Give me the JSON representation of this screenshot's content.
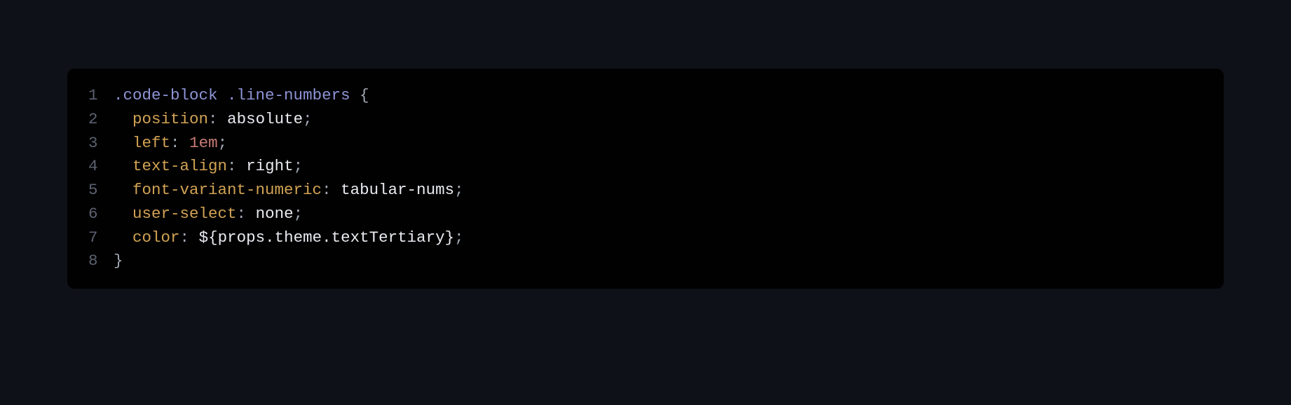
{
  "code": {
    "lines": [
      {
        "n": "1",
        "indent": "",
        "tokens": [
          {
            "cls": "tok-selector",
            "t": ".code-block"
          },
          {
            "cls": "tok-value",
            "t": " "
          },
          {
            "cls": "tok-selector",
            "t": ".line-numbers"
          },
          {
            "cls": "tok-value",
            "t": " "
          },
          {
            "cls": "tok-punct",
            "t": "{"
          }
        ]
      },
      {
        "n": "2",
        "indent": "  ",
        "tokens": [
          {
            "cls": "tok-prop",
            "t": "position"
          },
          {
            "cls": "tok-punct",
            "t": ":"
          },
          {
            "cls": "tok-value",
            "t": " absolute"
          },
          {
            "cls": "tok-punct",
            "t": ";"
          }
        ]
      },
      {
        "n": "3",
        "indent": "  ",
        "tokens": [
          {
            "cls": "tok-prop",
            "t": "left"
          },
          {
            "cls": "tok-punct",
            "t": ":"
          },
          {
            "cls": "tok-value",
            "t": " "
          },
          {
            "cls": "tok-num",
            "t": "1"
          },
          {
            "cls": "tok-unit",
            "t": "em"
          },
          {
            "cls": "tok-punct",
            "t": ";"
          }
        ]
      },
      {
        "n": "4",
        "indent": "  ",
        "tokens": [
          {
            "cls": "tok-prop",
            "t": "text-align"
          },
          {
            "cls": "tok-punct",
            "t": ":"
          },
          {
            "cls": "tok-value",
            "t": " right"
          },
          {
            "cls": "tok-punct",
            "t": ";"
          }
        ]
      },
      {
        "n": "5",
        "indent": "  ",
        "tokens": [
          {
            "cls": "tok-prop",
            "t": "font-variant-numeric"
          },
          {
            "cls": "tok-punct",
            "t": ":"
          },
          {
            "cls": "tok-value",
            "t": " tabular-nums"
          },
          {
            "cls": "tok-punct",
            "t": ";"
          }
        ]
      },
      {
        "n": "6",
        "indent": "  ",
        "tokens": [
          {
            "cls": "tok-prop",
            "t": "user-select"
          },
          {
            "cls": "tok-punct",
            "t": ":"
          },
          {
            "cls": "tok-value",
            "t": " none"
          },
          {
            "cls": "tok-punct",
            "t": ";"
          }
        ]
      },
      {
        "n": "7",
        "indent": "  ",
        "tokens": [
          {
            "cls": "tok-prop",
            "t": "color"
          },
          {
            "cls": "tok-punct",
            "t": ":"
          },
          {
            "cls": "tok-value",
            "t": " "
          },
          {
            "cls": "tok-interp",
            "t": "${props.theme.textTertiary}"
          },
          {
            "cls": "tok-punct",
            "t": ";"
          }
        ]
      },
      {
        "n": "8",
        "indent": "",
        "tokens": [
          {
            "cls": "tok-punct",
            "t": "}"
          }
        ]
      }
    ]
  }
}
